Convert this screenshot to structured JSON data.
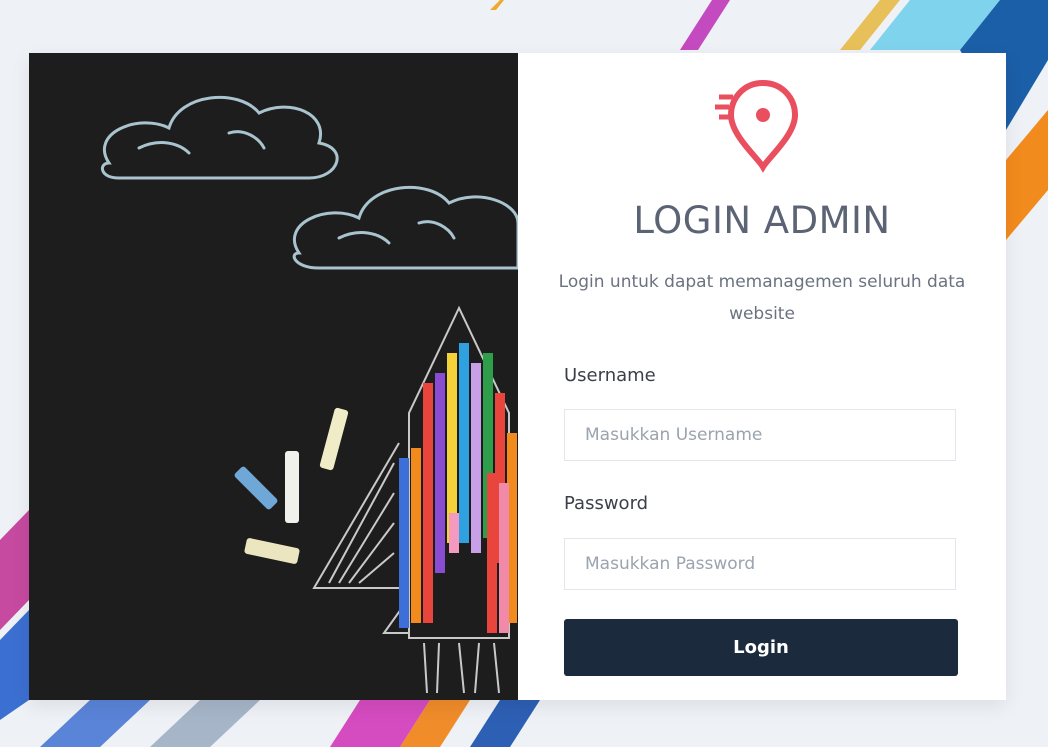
{
  "login": {
    "title": "LOGIN ADMIN",
    "subtitle": "Login untuk dapat memanagemen seluruh data website",
    "username_label": "Username",
    "username_placeholder": "Masukkan Username",
    "password_label": "Password",
    "password_placeholder": "Masukkan Password",
    "submit_label": "Login",
    "logo_icon": "location-pin-icon"
  },
  "colors": {
    "accent": "#e94f5f",
    "button": "#1b2a3d",
    "chalkboard": "#1c1c1c"
  }
}
